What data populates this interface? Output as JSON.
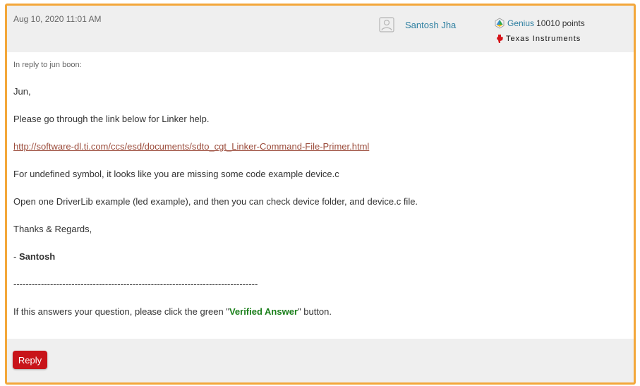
{
  "post": {
    "date": "Aug 10, 2020 11:01 AM",
    "author": "Santosh Jha",
    "rank_title": "Genius",
    "points": "10010 points",
    "company": "Texas Instruments",
    "reply_to": "In reply to jun boon:",
    "lines": {
      "greeting": "Jun,",
      "p1": "Please go through the link below for Linker help.",
      "link": "http://software-dl.ti.com/ccs/esd/documents/sdto_cgt_Linker-Command-File-Primer.html",
      "p2": "For undefined symbol, it looks like you are missing some code example device.c",
      "p3": "Open one DriverLib example (led example), and then you can check device folder, and device.c file.",
      "p4": "Thanks & Regards,",
      "sig_prefix": "- ",
      "sig_name": "Santosh",
      "divider": "--------------------------------------------------------------------------------",
      "p5_before": "If this answers your question, please click the green \"",
      "p5_bold": "Verified Answer",
      "p5_after": "\" button."
    },
    "reply_label": "Reply"
  },
  "colors": {
    "border": "#f3a73a",
    "link": "#9b4b3a",
    "author": "#2c7ea0",
    "verified": "#1a7f1a",
    "reply_button": "#c8141a"
  },
  "icons": {
    "avatar": "user-avatar-icon",
    "rank": "genius-rank-icon",
    "company": "ti-logo-icon"
  }
}
